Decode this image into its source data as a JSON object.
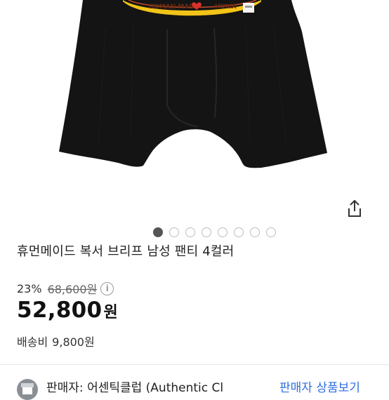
{
  "product": {
    "image_alt": "black boxer brief",
    "waistband_text": "HUMAN MADE",
    "waistband_text_right": "HUMA",
    "title": "휴먼메이드 복서 브리프 남성 팬티 4컬러",
    "discount": "23%",
    "original_price": "68,600원",
    "price_number": "52,800",
    "price_unit": "원",
    "shipping_label": "배송비",
    "shipping_value": "9,800원"
  },
  "carousel": {
    "count": 8,
    "active_index": 0
  },
  "seller": {
    "prefix": "판매자:",
    "name": "어센틱클럽 (Authentic Cl",
    "link_label": "판매자 상품보기"
  },
  "icons": {
    "share": "share-icon",
    "info": "info-icon"
  },
  "colors": {
    "accent_link": "#2f6fe0",
    "garment": "#141414",
    "waistband": "#f2c418"
  }
}
